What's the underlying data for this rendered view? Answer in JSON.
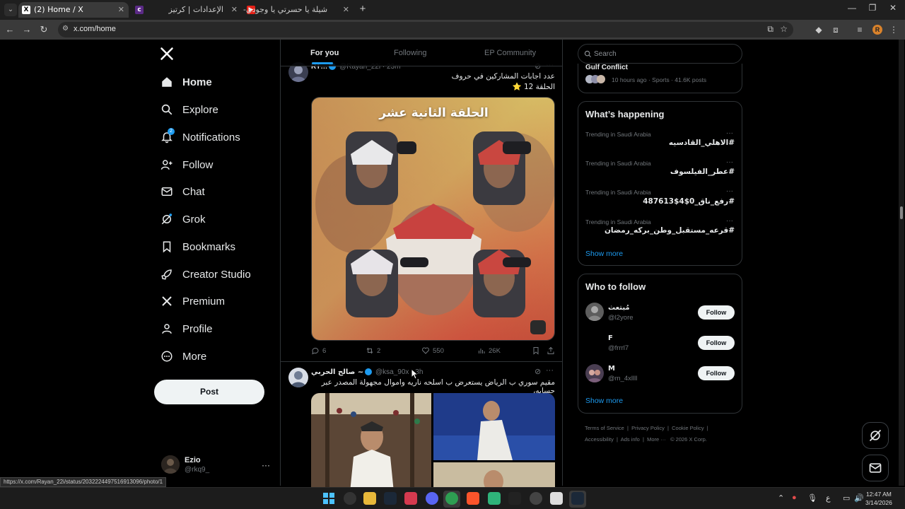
{
  "browser": {
    "tabs": [
      {
        "title": "(2) Home / X",
        "favicon": "x-logo",
        "active": true
      },
      {
        "title": "الإعدادات | كرتيز",
        "favicon": "purple-c",
        "active": false
      },
      {
        "title": "شيلة يا حسرتي يا وجودي- علي ح",
        "favicon": "youtube",
        "active": false
      }
    ],
    "url": "x.com/home",
    "new_tab": "+",
    "profile_initial": "R",
    "status_url": "https://x.com/Rayan_22i/status/2032224497516913096/photo/1"
  },
  "nav": {
    "logo": "X",
    "items": [
      {
        "label": "Home",
        "icon": "home-icon",
        "active": true
      },
      {
        "label": "Explore",
        "icon": "search-icon"
      },
      {
        "label": "Notifications",
        "icon": "bell-icon",
        "badge": "2"
      },
      {
        "label": "Follow",
        "icon": "person-add-icon"
      },
      {
        "label": "Chat",
        "icon": "mail-icon"
      },
      {
        "label": "Grok",
        "icon": "grok-icon"
      },
      {
        "label": "Bookmarks",
        "icon": "bookmark-icon"
      },
      {
        "label": "Creator Studio",
        "icon": "rocket-icon"
      },
      {
        "label": "Premium",
        "icon": "x-icon"
      },
      {
        "label": "Profile",
        "icon": "profile-icon"
      },
      {
        "label": "More",
        "icon": "more-circle-icon"
      }
    ],
    "post_label": "Post",
    "account": {
      "name": "Ezio",
      "handle": "@rkq9_",
      "more": "···"
    }
  },
  "feed": {
    "tabs": [
      "For you",
      "Following",
      "EP Community"
    ],
    "tweet1": {
      "name": "RT…",
      "handle": "@Rayan_22i · 23m",
      "text_line1": "عدد اجابات المشاركين في حروف",
      "text_line2": "الحلقة 12 ⭐",
      "image_caption": "الحلقة الثانية عشر",
      "replies": "6",
      "reposts": "2",
      "likes": "550",
      "views": "26K"
    },
    "tweet2": {
      "name": "صالح الحربي ~",
      "handle": "@ksa_90x · 3h",
      "text": "مقيم سوري ب الرياض يستعرض ب اسلحه ناريه  واموال مجهولة المصدر عبر حسابه،"
    }
  },
  "right": {
    "search_placeholder": "Search",
    "top_card": {
      "title": "Gulf Conflict",
      "meta": "10 hours ago · Sports · 41.6K posts"
    },
    "happening": {
      "title": "What’s happening",
      "trends": [
        {
          "meta": "Trending in Saudi Arabia",
          "name": "#الاهلي_القادسيه"
        },
        {
          "meta": "Trending in Saudi Arabia",
          "name": "#عطر_الفيلسوف"
        },
        {
          "meta": "Trending in Saudi Arabia",
          "name": "#رفع_ناق_0$4$487613"
        },
        {
          "meta": "Trending in Saudi Arabia",
          "name": "#قرعه_مستقبل_وطن_بركه_رمضان"
        }
      ],
      "show_more": "Show more"
    },
    "who_to_follow": {
      "title": "Who to follow",
      "users": [
        {
          "name": "مُبتعث",
          "handle": "@l2yore",
          "button": "Follow"
        },
        {
          "name": "F",
          "handle": "@frrrl7",
          "button": "Follow"
        },
        {
          "name": "M",
          "handle": "@m_4xllll",
          "button": "Follow"
        }
      ],
      "show_more": "Show more"
    },
    "footer": {
      "line1": [
        "Terms of Service",
        "Privacy Policy",
        "Cookie Policy"
      ],
      "line2": [
        "Accessibility",
        "Ads info",
        "More ···",
        "© 2026 X Corp."
      ]
    }
  },
  "taskbar": {
    "clock_time": "12:47 AM",
    "clock_date": "3/14/2026"
  },
  "colors": {
    "accent": "#1d9bf0",
    "background": "#000000",
    "text": "#e7e9ea",
    "muted": "#71767b"
  }
}
